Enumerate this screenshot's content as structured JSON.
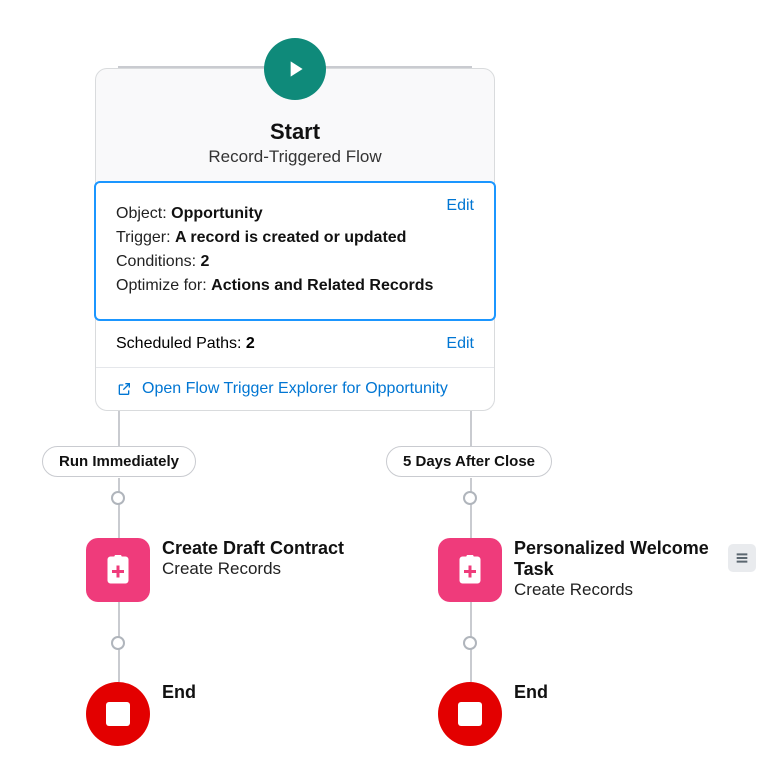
{
  "start": {
    "title": "Start",
    "subtitle": "Record-Triggered Flow",
    "edit_link": "Edit",
    "details": {
      "object_label": "Object:",
      "object_value": "Opportunity",
      "trigger_label": "Trigger:",
      "trigger_value": "A record is created or updated",
      "conditions_label": "Conditions:",
      "conditions_value": "2",
      "optimize_label": "Optimize for:",
      "optimize_value": "Actions and Related Records"
    },
    "scheduled": {
      "label": "Scheduled Paths:",
      "value": "2",
      "edit_link": "Edit"
    },
    "explorer_link": "Open Flow Trigger Explorer for Opportunity"
  },
  "paths": {
    "left": {
      "pill": "Run Immediately",
      "element": {
        "title": "Create Draft Contract",
        "sub": "Create Records"
      },
      "end": "End"
    },
    "right": {
      "pill": "5 Days After Close",
      "element": {
        "title": "Personalized Welcome Task",
        "sub": "Create Records"
      },
      "end": "End"
    }
  }
}
